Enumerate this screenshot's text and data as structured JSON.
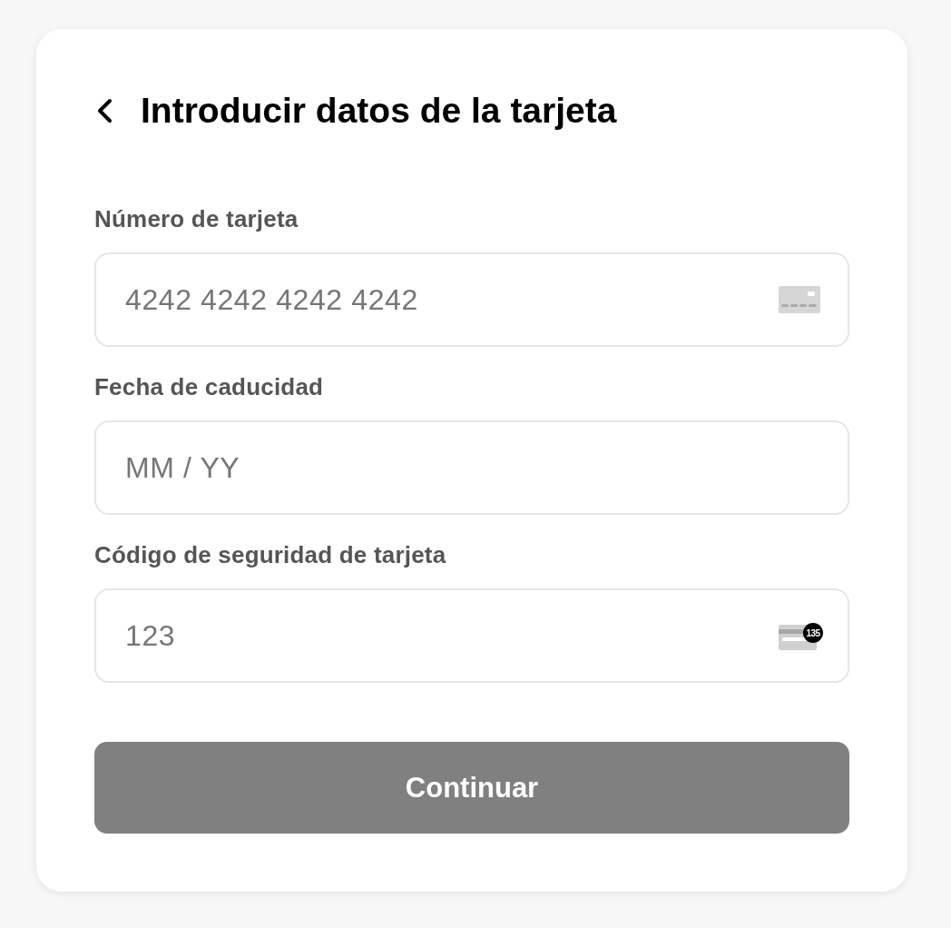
{
  "header": {
    "title": "Introducir datos de la tarjeta"
  },
  "fields": [
    {
      "kind": "card-number",
      "label": "Número de tarjeta",
      "placeholder": "4242 4242 4242 4242"
    },
    {
      "kind": "date",
      "label": "Fecha de caducidad",
      "placeholder": "MM / YY"
    },
    {
      "kind": "security-code",
      "label": "Código de seguridad de tarjeta",
      "placeholder": "123",
      "icon_badge": "135"
    }
  ],
  "submit": {
    "label": "Continuar",
    "disabled": true
  }
}
